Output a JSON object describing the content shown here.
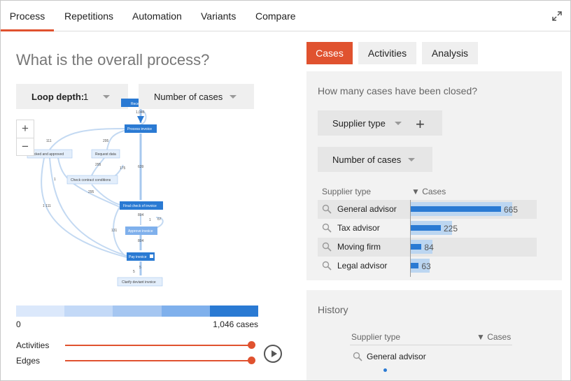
{
  "topnav": {
    "tabs": [
      {
        "label": "Process",
        "active": true
      },
      {
        "label": "Repetitions",
        "active": false
      },
      {
        "label": "Automation",
        "active": false
      },
      {
        "label": "Variants",
        "active": false
      },
      {
        "label": "Compare",
        "active": false
      }
    ],
    "expand_icon": "expand-icon"
  },
  "left": {
    "title": "What is the overall process?",
    "loop_depth_label": "Loop depth:",
    "loop_depth_value": "1",
    "metric_select": "Number of cases",
    "zoom_in": "+",
    "zoom_out": "−",
    "graph": {
      "nodes": {
        "receive": "Rece",
        "process_invoice": "Process invoice",
        "request_data": "Request data",
        "checked_approved": "hecked and approved",
        "check_contract": "Check contract conditions",
        "final_check": "Final check of invoice",
        "approve_invoice": "Approve invoice",
        "pay_invoice": "Pay invoice",
        "clarify": "Clarify deviant invoice"
      },
      "edges": {
        "e1046": "1,046",
        "e111": "111",
        "e295a": "295",
        "e295b": "295",
        "e175": "175",
        "e639": "639",
        "e1": "1",
        "e295c": "295",
        "e1111": "1 111",
        "e804a": "804",
        "e1b": "1",
        "e67": "67",
        "e131": "131",
        "e804b": "804",
        "e5a": "5",
        "e5b": "5"
      }
    },
    "legend": {
      "min": "0",
      "max": "1,046 cases",
      "colors": [
        "#dbe8fb",
        "#c3d9f7",
        "#a5c6f1",
        "#7fb0ec",
        "#2a7ad3"
      ]
    },
    "sliders": {
      "activities_label": "Activities",
      "activities_value": 1.0,
      "edges_label": "Edges",
      "edges_value": 1.0
    },
    "play_icon": "play-icon"
  },
  "right": {
    "tabs": [
      {
        "label": "Cases",
        "active": true
      },
      {
        "label": "Activities",
        "active": false
      },
      {
        "label": "Analysis",
        "active": false
      }
    ],
    "closed_card": {
      "title": "How many cases have been closed?",
      "group_select": "Supplier type",
      "add_icon": "plus-icon",
      "metric_select": "Number of cases",
      "col_supplier": "Supplier type",
      "col_cases": "▼ Cases",
      "rows": [
        {
          "name": "General advisor",
          "value": "665"
        },
        {
          "name": "Tax advisor",
          "value": "225"
        },
        {
          "name": "Moving firm",
          "value": "84"
        },
        {
          "name": "Legal advisor",
          "value": "63"
        }
      ]
    },
    "history_card": {
      "title": "History",
      "col_supplier": "Supplier type",
      "col_cases": "▼ Cases",
      "rows": [
        {
          "name": "General advisor"
        }
      ]
    }
  },
  "colors": {
    "accent": "#e0522f",
    "bar": "#2a7ad3",
    "bar_bg": "#bcd6f1"
  }
}
